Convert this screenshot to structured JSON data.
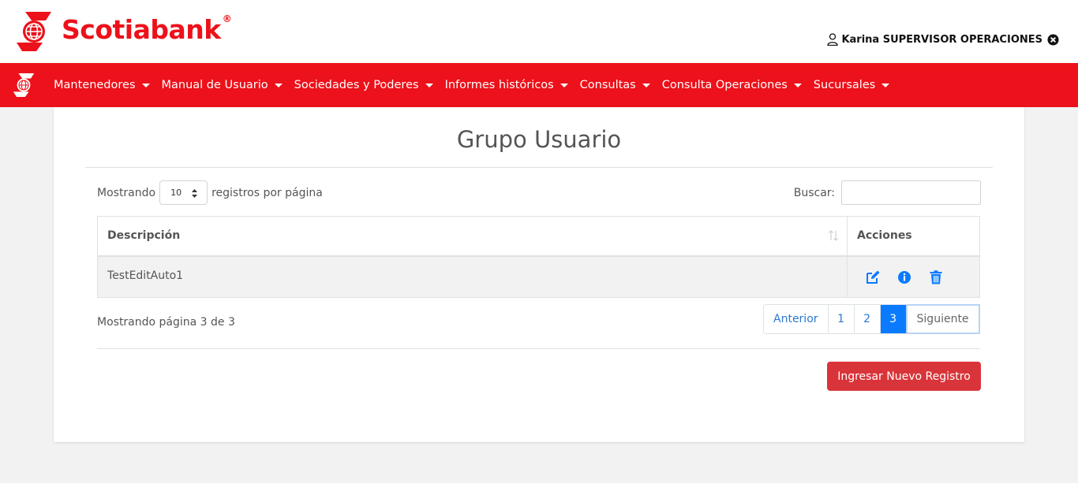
{
  "brand": {
    "name": "Scotiabank",
    "registered": "®",
    "color": "#ec111a"
  },
  "user": {
    "name": "Karina SUPERVISOR OPERACIONES"
  },
  "nav": {
    "items": [
      {
        "label": "Mantenedores"
      },
      {
        "label": "Manual de Usuario"
      },
      {
        "label": "Sociedades y Poderes"
      },
      {
        "label": "Informes históricos"
      },
      {
        "label": "Consultas"
      },
      {
        "label": "Consulta Operaciones"
      },
      {
        "label": "Sucursales"
      }
    ]
  },
  "page": {
    "title": "Grupo Usuario",
    "length": {
      "prefix": "Mostrando",
      "value": "10",
      "suffix": "registros por página"
    },
    "search": {
      "label": "Buscar:",
      "value": ""
    },
    "table": {
      "headers": {
        "description": "Descripción",
        "actions": "Acciones"
      },
      "rows": [
        {
          "description": "TestEditAuto1"
        }
      ]
    },
    "info": "Mostrando página 3 de 3",
    "pagination": {
      "prev": "Anterior",
      "pages": [
        "1",
        "2",
        "3"
      ],
      "active": "3",
      "next": "Siguiente"
    },
    "new_button": "Ingresar Nuevo Registro"
  },
  "icons": [
    "scotiabank-logo-icon",
    "user-icon",
    "close-circle-icon",
    "sort-icon",
    "edit-icon",
    "info-icon",
    "trash-icon"
  ],
  "colors": {
    "nav_bg": "#ec111a",
    "link": "#2a7ad0",
    "active_page": "#0a7bff",
    "button": "#d9343a"
  }
}
